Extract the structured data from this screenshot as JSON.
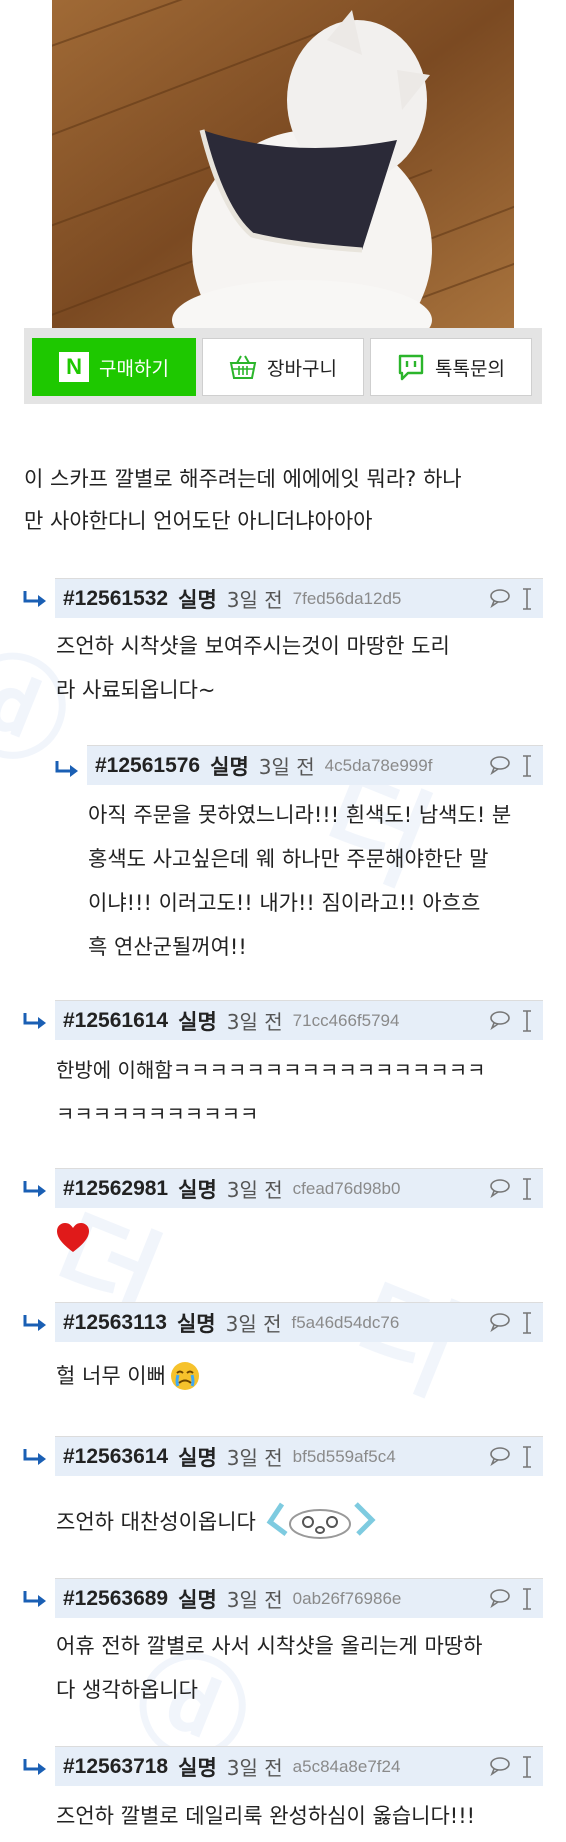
{
  "buy_bar": {
    "naver_label": "구매하기",
    "naver_logo": "N",
    "cart_label": "장바구니",
    "talk_label": "톡톡문의"
  },
  "post": {
    "line1": "이 스카프 깔별로 해주려는데 에에에잇 뭐라? 하나",
    "line2": "만 사야한다니 언어도단 아니더냐아아아"
  },
  "comments": [
    {
      "num": "#12561532",
      "anon": "실명",
      "days": "3일 전",
      "hash": "7fed56da12d5",
      "lines": [
        "즈언하 시착샷을 보여주시는것이 마땅한 도리",
        "라 사료되옵니다~"
      ]
    },
    {
      "num": "#12561576",
      "anon": "실명",
      "days": "3일 전",
      "hash": "4c5da78e999f",
      "lines": [
        "아직 주문을 못하였느니라!!! 흰색도! 남색도! 분",
        "홍색도 사고싶은데 웨 하나만 주문해야한단 말",
        "이냐!!! 이러고도!! 내가!! 짐이라고!! 아흐흐",
        "흑 연산군될꺼여!!"
      ]
    },
    {
      "num": "#12561614",
      "anon": "실명",
      "days": "3일 전",
      "hash": "71cc466f5794",
      "lines": [
        "한방에 이해함ㅋㅋㅋㅋㅋㅋㅋㅋㅋㅋㅋㅋㅋㅋㅋㅋㅋ",
        "ㅋㅋㅋㅋㅋㅋㅋㅋㅋㅋㅋ"
      ]
    },
    {
      "num": "#12562981",
      "anon": "실명",
      "days": "3일 전",
      "hash": "cfead76d98b0",
      "lines": []
    },
    {
      "num": "#12563113",
      "anon": "실명",
      "days": "3일 전",
      "hash": "f5a46d54dc76",
      "lines": [
        "헐 너무 이뻐"
      ]
    },
    {
      "num": "#12563614",
      "anon": "실명",
      "days": "3일 전",
      "hash": "bf5d559af5c4",
      "lines": [
        "즈언하 대찬성이옵니다"
      ]
    },
    {
      "num": "#12563689",
      "anon": "실명",
      "days": "3일 전",
      "hash": "0ab26f76986e",
      "lines": [
        "어휴 전하 깔별로 사서 시착샷을 올리는게 마땅하",
        "다 생각하옵니다"
      ]
    },
    {
      "num": "#12563718",
      "anon": "실명",
      "days": "3일 전",
      "hash": "a5c84a8e7f24",
      "lines": [
        "즈언하 깔별로 데일리룩 완성하심이 옳습니다!!!"
      ]
    }
  ],
  "icons": {
    "reply_arrow": "reply-arrow-icon",
    "comment_bubble": "speech-bubble-icon",
    "cursor": "text-cursor-icon",
    "heart": "heart-emoji-icon",
    "crying": "crying-emoji-icon",
    "cheer": "cheer-emoticon-icon"
  },
  "colors": {
    "naver_green": "#1ec800",
    "comment_header_bg": "#e6eef8",
    "reply_arrow": "#1a5fb4",
    "heart": "#e01a1a"
  }
}
